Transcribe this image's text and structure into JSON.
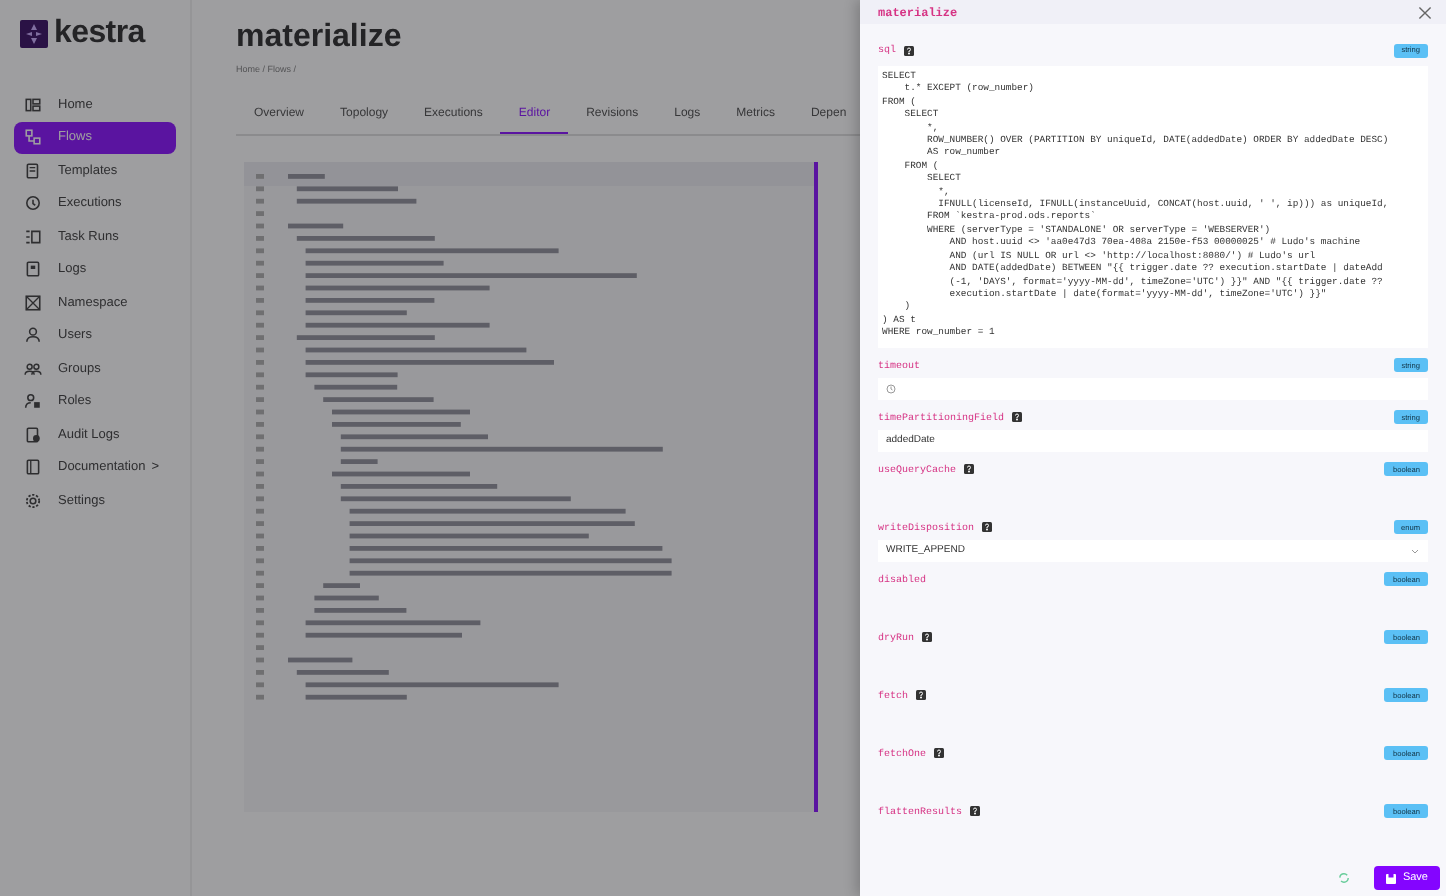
{
  "app": {
    "logo": "kestra"
  },
  "sidebar": {
    "items": [
      {
        "label": "Home",
        "selected": false
      },
      {
        "label": "Flows",
        "selected": true
      },
      {
        "label": "Templates",
        "selected": false
      },
      {
        "label": "Executions",
        "selected": false
      },
      {
        "label": "Task Runs",
        "selected": false
      },
      {
        "label": "Logs",
        "selected": false
      },
      {
        "label": "Namespace",
        "selected": false
      },
      {
        "label": "Users",
        "selected": false
      },
      {
        "label": "Groups",
        "selected": false
      },
      {
        "label": "Roles",
        "selected": false
      },
      {
        "label": "Audit Logs",
        "selected": false
      },
      {
        "label": "Documentation",
        "selected": false,
        "suffix": ">"
      },
      {
        "label": "Settings",
        "selected": false
      }
    ]
  },
  "page": {
    "title": "materialize",
    "breadcrumb": "Home / Flows /",
    "tabs": [
      {
        "label": "Overview",
        "selected": false
      },
      {
        "label": "Topology",
        "selected": false
      },
      {
        "label": "Executions",
        "selected": false
      },
      {
        "label": "Editor",
        "selected": true
      },
      {
        "label": "Revisions",
        "selected": false
      },
      {
        "label": "Logs",
        "selected": false
      },
      {
        "label": "Metrics",
        "selected": false
      },
      {
        "label": "Depen",
        "selected": false
      }
    ]
  },
  "panel": {
    "title": "materialize",
    "fields": [
      {
        "name": "sql",
        "help": true,
        "type": "string",
        "kind": "code",
        "value": "SELECT\n    t.* EXCEPT (row_number)\nFROM (\n    SELECT\n        *,\n        ROW_NUMBER() OVER (PARTITION BY uniqueId, DATE(addedDate) ORDER BY addedDate DESC)\n        AS row_number\n    FROM (\n        SELECT\n          *,\n          IFNULL(licenseId, IFNULL(instanceUuid, CONCAT(host.uuid, ' ', ip))) as uniqueId,\n        FROM `kestra-prod.ods.reports`\n        WHERE (serverType = 'STANDALONE' OR serverType = 'WEBSERVER')\n            AND host.uuid <> 'aa0e47d3 70ea-408a 2150e-f53 00000025' # Ludo's machine\n            AND (url IS NULL OR url <> 'http://localhost:8080/') # Ludo's url\n            AND DATE(addedDate) BETWEEN \"{{ trigger.date ?? execution.startDate | dateAdd\n            (-1, 'DAYS', format='yyyy-MM-dd', timeZone='UTC') }}\" AND \"{{ trigger.date ??\n            execution.startDate | date(format='yyyy-MM-dd', timeZone='UTC') }}\"\n    )\n) AS t\nWHERE row_number = 1"
      },
      {
        "name": "timeout",
        "help": false,
        "type": "string",
        "kind": "duration"
      },
      {
        "name": "timePartitioningField",
        "help": true,
        "type": "string",
        "kind": "text",
        "value": "addedDate"
      },
      {
        "name": "useQueryCache",
        "help": true,
        "type": "boolean",
        "kind": "boolean"
      },
      {
        "name": "writeDisposition",
        "help": true,
        "type": "enum",
        "kind": "select",
        "value": "WRITE_APPEND"
      },
      {
        "name": "disabled",
        "help": false,
        "type": "boolean",
        "kind": "boolean"
      },
      {
        "name": "dryRun",
        "help": true,
        "type": "boolean",
        "kind": "boolean"
      },
      {
        "name": "fetch",
        "help": true,
        "type": "boolean",
        "kind": "boolean"
      },
      {
        "name": "fetchOne",
        "help": true,
        "type": "boolean",
        "kind": "boolean"
      },
      {
        "name": "flattenResults",
        "help": true,
        "type": "boolean",
        "kind": "boolean"
      }
    ],
    "save": "Save"
  }
}
